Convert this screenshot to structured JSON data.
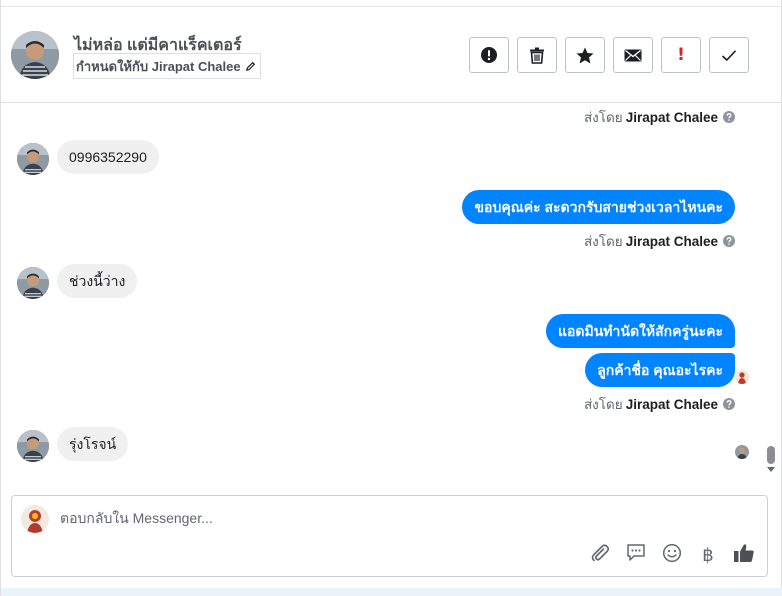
{
  "header": {
    "customer_name": "ไม่หล่อ แต่มีคาแร็คเตอร์",
    "assign_label": "กำหนดให้กับ Jirapat Chalee",
    "actions": [
      {
        "name": "spam-button",
        "icon": "exclamation-circle-icon"
      },
      {
        "name": "delete-button",
        "icon": "trash-icon"
      },
      {
        "name": "star-button",
        "icon": "star-icon"
      },
      {
        "name": "mark-unread-button",
        "icon": "envelope-icon"
      },
      {
        "name": "follow-up-button",
        "icon": "exclamation-icon",
        "label": "!"
      },
      {
        "name": "done-button",
        "icon": "checkmark-icon"
      }
    ]
  },
  "conversation": {
    "sent_by_prefix": "ส่งโดย",
    "agent_name": "Jirapat Chalee",
    "messages": [
      {
        "from": "customer",
        "text": "0996352290"
      },
      {
        "from": "page",
        "text": "ขอบคุณค่ะ สะดวกรับสายช่วงเวลาไหนคะ"
      },
      {
        "from": "customer",
        "text": "ช่วงนี้ว่าง"
      },
      {
        "from": "page",
        "text": "แอดมินทำนัดให้สักครู่นะคะ"
      },
      {
        "from": "page",
        "text": "ลูกค้าชื่อ คุณอะไรคะ"
      },
      {
        "from": "customer",
        "text": "รุ่งโรจน์"
      }
    ]
  },
  "reply": {
    "placeholder": "ตอบกลับใน Messenger...",
    "tools": [
      "paperclip-icon",
      "saved-reply-icon",
      "emoji-icon",
      "baht-icon",
      "thumbs-up-icon"
    ],
    "baht_symbol": "฿"
  },
  "colors": {
    "accent": "#0084ff",
    "incoming_bubble": "#f0f0f0",
    "follow_up_red": "#e02020"
  }
}
